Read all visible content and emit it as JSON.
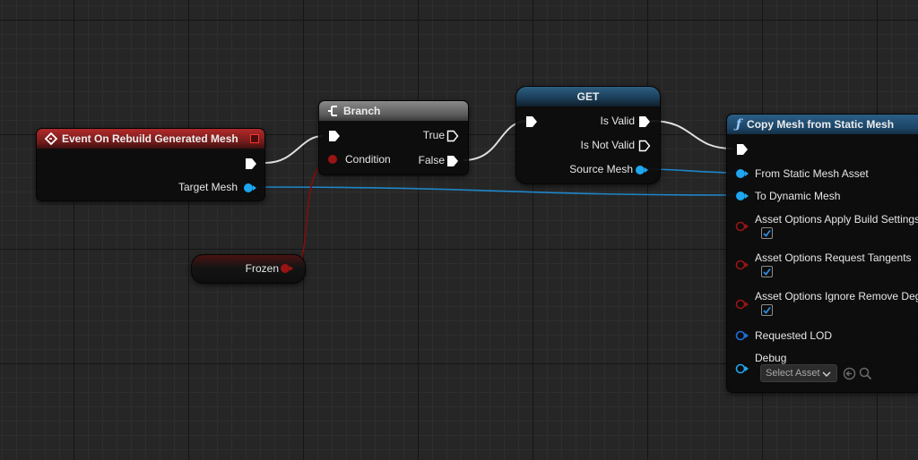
{
  "nodes": {
    "event": {
      "title": "Event On Rebuild Generated Mesh",
      "outputs": {
        "target_mesh": "Target Mesh"
      },
      "color": "#8b2020"
    },
    "branch": {
      "title": "Branch",
      "inputs": {
        "condition": "Condition"
      },
      "outputs": {
        "true_label": "True",
        "false_label": "False"
      }
    },
    "frozen": {
      "label": "Frozen"
    },
    "get": {
      "title": "GET",
      "outputs": {
        "is_valid": "Is Valid",
        "is_not_valid": "Is Not Valid",
        "source_mesh": "Source Mesh"
      }
    },
    "copy": {
      "title": "Copy Mesh from Static Mesh",
      "inputs": {
        "from_static_mesh_asset": "From Static Mesh Asset",
        "to_dynamic_mesh": "To Dynamic Mesh",
        "apply_build_settings": "Asset Options Apply Build Settings",
        "request_tangents": "Asset Options Request Tangents",
        "ignore_remove_degenerates": "Asset Options Ignore Remove Dege",
        "requested_lod": "Requested LOD",
        "debug": "Debug"
      },
      "checkboxes": {
        "apply_build_settings": true,
        "request_tangents": true,
        "ignore_remove_degenerates": true
      },
      "debug_select": "Select Asset"
    }
  },
  "colors": {
    "exec": "#ffffff",
    "object_pin": "#1ea6f0",
    "bool_pin": "#9a1414",
    "int_pin": "#1e6ee0",
    "wire_exec": "#e0e0e0",
    "wire_object": "#1e86c8",
    "wire_bool": "#7a1010"
  },
  "icons": {
    "event": "event-diamond-icon",
    "branch": "branch-icon",
    "function": "function-f-icon",
    "dropdown": "chevron-down-icon",
    "use_asset": "use-selected-asset-icon",
    "browse": "search-icon"
  }
}
